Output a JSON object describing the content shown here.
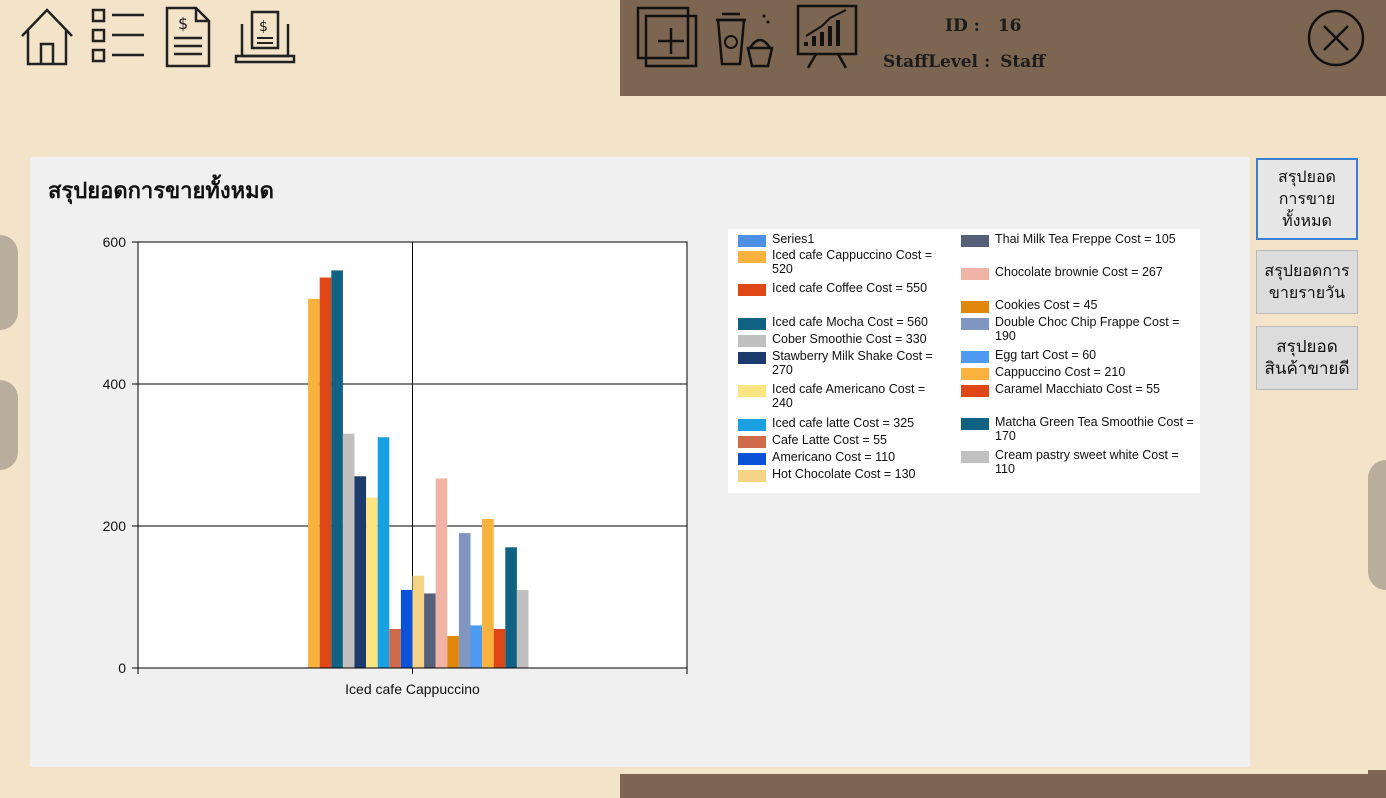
{
  "header": {
    "id_label": "ID :",
    "id_value": "16",
    "staff_level_label": "StaffLevel :",
    "staff_level_value": "Staff"
  },
  "nav_icons": [
    "home-icon",
    "list-icon",
    "invoice-icon",
    "receipt-laptop-icon",
    "add-product-icon",
    "coffee-cake-icon",
    "sales-chart-icon",
    "close-icon"
  ],
  "side_buttons": [
    {
      "label": "สรุปยอด การขาย ทั้งหมด"
    },
    {
      "label": "สรุปยอดการ ขายรายวัน"
    },
    {
      "label": "สรุปยอด สินค้าขายดี"
    }
  ],
  "chart_data": {
    "type": "bar",
    "title": "สรุปยอดการขายทั้งหมด",
    "categories": [
      "Iced cafe Cappuccino"
    ],
    "ylim": [
      0,
      600
    ],
    "yticks": [
      "0",
      "200",
      "400",
      "600"
    ],
    "grid": true,
    "legend_position": "right",
    "series": [
      {
        "name": "Series1",
        "values": [
          0
        ],
        "color": "#4e8fe6"
      },
      {
        "name": "Iced cafe Cappuccino Cost = 520",
        "values": [
          520
        ],
        "color": "#f8b23d"
      },
      {
        "name": "Iced cafe Coffee  Cost = 550",
        "values": [
          550
        ],
        "color": "#e04717"
      },
      {
        "name": "Iced cafe Mocha Cost = 560",
        "values": [
          560
        ],
        "color": "#106283"
      },
      {
        "name": "Cober Smoothie Cost = 330",
        "values": [
          330
        ],
        "color": "#c0c0c0"
      },
      {
        "name": "Stawberry Milk Shake  Cost = 270",
        "values": [
          270
        ],
        "color": "#1d3a6c"
      },
      {
        "name": "Iced cafe Americano Cost = 240",
        "values": [
          240
        ],
        "color": "#fbe482"
      },
      {
        "name": "Iced cafe latte Cost = 325",
        "values": [
          325
        ],
        "color": "#18a0e0"
      },
      {
        "name": "Cafe Latte Cost = 55",
        "values": [
          55
        ],
        "color": "#cf6a4a"
      },
      {
        "name": "Americano Cost = 110",
        "values": [
          110
        ],
        "color": "#0a53d8"
      },
      {
        "name": "Hot Chocolate Cost = 130",
        "values": [
          130
        ],
        "color": "#f4d387"
      },
      {
        "name": "Thai Milk Tea Freppe Cost = 105",
        "values": [
          105
        ],
        "color": "#566179"
      },
      {
        "name": "Chocolate brownie Cost = 267",
        "values": [
          267
        ],
        "color": "#efb4a6"
      },
      {
        "name": "Cookies Cost = 45",
        "values": [
          45
        ],
        "color": "#e0860a"
      },
      {
        "name": "Double Choc Chip Frappe Cost = 190",
        "values": [
          190
        ],
        "color": "#7f96c0"
      },
      {
        "name": "Egg tart Cost = 60",
        "values": [
          60
        ],
        "color": "#4e9af0"
      },
      {
        "name": "Cappuccino Cost = 210",
        "values": [
          210
        ],
        "color": "#f8b23d"
      },
      {
        "name": "Caramel Macchiato Cost = 55",
        "values": [
          55
        ],
        "color": "#e04717"
      },
      {
        "name": "Matcha Green Tea Smoothie Cost = 170",
        "values": [
          170
        ],
        "color": "#106283"
      },
      {
        "name": "Cream pastry sweet white Cost = 110",
        "values": [
          110
        ],
        "color": "#c0c0c0"
      }
    ]
  }
}
